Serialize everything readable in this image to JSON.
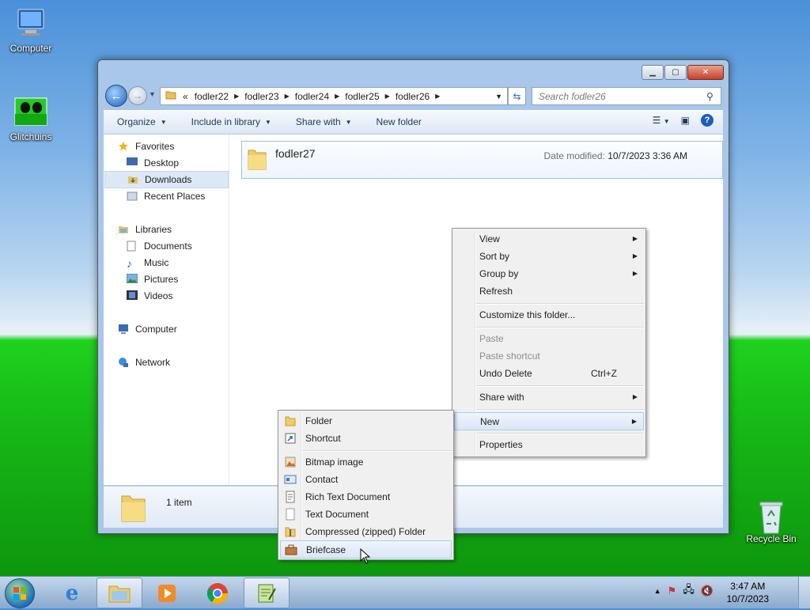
{
  "desktop": {
    "icons": [
      {
        "label": "Computer"
      },
      {
        "label": "Glitchuins"
      },
      {
        "label": "Recycle Bin"
      }
    ]
  },
  "window": {
    "address": {
      "overflow": "«",
      "crumbs": [
        "fodler22",
        "fodler23",
        "fodler24",
        "fodler25",
        "fodler26"
      ]
    },
    "search": {
      "placeholder": "Search fodler26"
    },
    "toolbar": {
      "organize": "Organize",
      "include": "Include in library",
      "share": "Share with",
      "new_folder": "New folder"
    },
    "nav": {
      "favorites": "Favorites",
      "desktop": "Desktop",
      "downloads": "Downloads",
      "recent": "Recent Places",
      "libraries": "Libraries",
      "documents": "Documents",
      "music": "Music",
      "pictures": "Pictures",
      "videos": "Videos",
      "computer": "Computer",
      "network": "Network"
    },
    "file": {
      "name": "fodler27",
      "date_label": "Date modified:",
      "date_value": "10/7/2023 3:36 AM"
    },
    "details": {
      "count": "1 item"
    }
  },
  "context_menu": {
    "view": "View",
    "sort_by": "Sort by",
    "group_by": "Group by",
    "refresh": "Refresh",
    "customize": "Customize this folder...",
    "paste": "Paste",
    "paste_shortcut": "Paste shortcut",
    "undo_delete": "Undo Delete",
    "undo_shortcut": "Ctrl+Z",
    "share_with": "Share with",
    "new": "New",
    "properties": "Properties"
  },
  "new_submenu": {
    "folder": "Folder",
    "shortcut": "Shortcut",
    "bitmap": "Bitmap image",
    "contact": "Contact",
    "rtf": "Rich Text Document",
    "text": "Text Document",
    "zip": "Compressed (zipped) Folder",
    "briefcase": "Briefcase"
  },
  "taskbar": {
    "time": "3:47 AM",
    "date": "10/7/2023"
  },
  "colors": {
    "selection": "#dbe7f6",
    "accent": "#1f5fb8",
    "desktop_green": "#17b817"
  }
}
